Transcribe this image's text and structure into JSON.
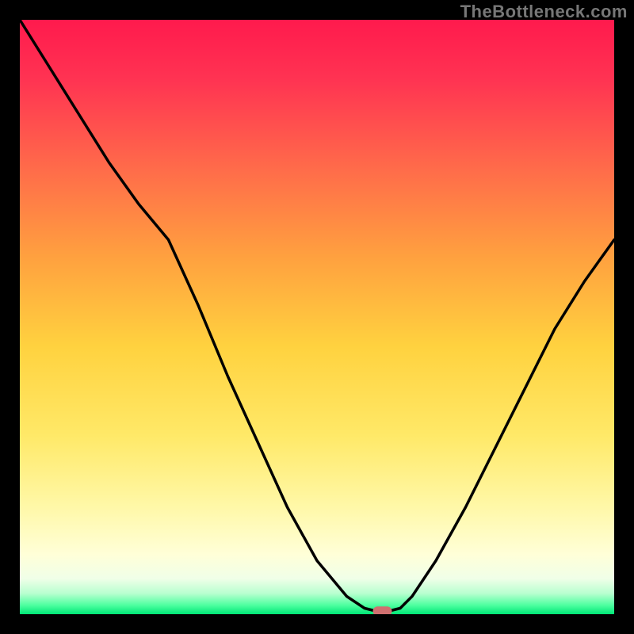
{
  "watermark": "TheBottleneck.com",
  "chart_data": {
    "type": "line",
    "title": "",
    "xlabel": "",
    "ylabel": "",
    "xlim": [
      0,
      100
    ],
    "ylim": [
      0,
      100
    ],
    "x": [
      0,
      5,
      10,
      15,
      20,
      25,
      30,
      35,
      40,
      45,
      50,
      55,
      58,
      60,
      62,
      64,
      66,
      70,
      75,
      80,
      85,
      90,
      95,
      100
    ],
    "values": [
      100,
      92,
      84,
      76,
      69,
      63,
      52,
      40,
      29,
      18,
      9,
      3,
      1,
      0.5,
      0.5,
      1,
      3,
      9,
      18,
      28,
      38,
      48,
      56,
      63
    ],
    "marker": {
      "x": 61,
      "y": 0.5
    },
    "colors": {
      "gradient_top": "#ff1744",
      "gradient_mid_upper": "#ff7043",
      "gradient_mid": "#ffd740",
      "gradient_mid_lower": "#fff59d",
      "gradient_low": "#ffffe0",
      "gradient_bottom": "#00e676",
      "line": "#000000",
      "marker": "#d07070",
      "frame": "#000000"
    }
  }
}
